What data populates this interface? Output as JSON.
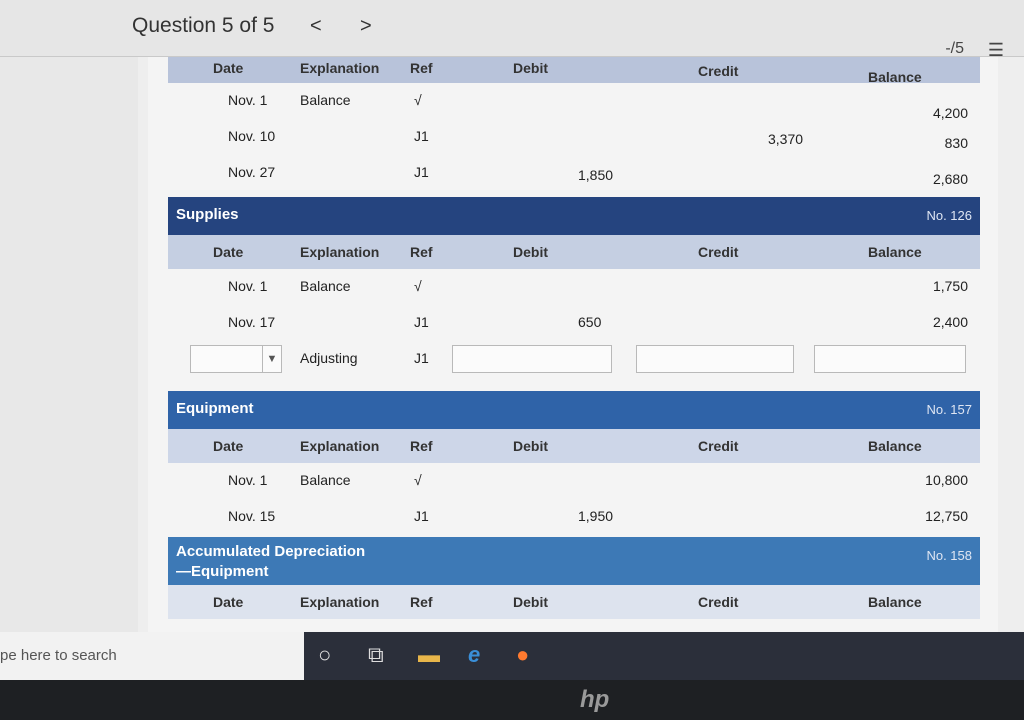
{
  "header": {
    "question": "Question 5 of 5",
    "prev": "<",
    "next": ">",
    "score": "-/5",
    "list_icon": "list-icon"
  },
  "columns": {
    "date": "Date",
    "explanation": "Explanation",
    "ref": "Ref",
    "debit": "Debit",
    "credit": "Credit",
    "balance": "Balance"
  },
  "cash": {
    "rows": [
      {
        "date": "Nov. 1",
        "exp": "Balance",
        "ref": "√",
        "debit": "",
        "credit": "",
        "balance": "4,200"
      },
      {
        "date": "Nov. 10",
        "exp": "",
        "ref": "J1",
        "debit": "",
        "credit": "3,370",
        "balance": "830"
      },
      {
        "date": "Nov. 27",
        "exp": "",
        "ref": "J1",
        "debit": "1,850",
        "credit": "",
        "balance": "2,680"
      }
    ]
  },
  "supplies": {
    "title": "Supplies",
    "no": "No. 126",
    "rows": [
      {
        "date": "Nov. 1",
        "exp": "Balance",
        "ref": "√",
        "debit": "",
        "credit": "",
        "balance": "1,750"
      },
      {
        "date": "Nov. 17",
        "exp": "",
        "ref": "J1",
        "debit": "650",
        "credit": "",
        "balance": "2,400"
      }
    ],
    "adjusting": {
      "exp": "Adjusting",
      "ref": "J1"
    }
  },
  "equipment": {
    "title": "Equipment",
    "no": "No. 157",
    "rows": [
      {
        "date": "Nov. 1",
        "exp": "Balance",
        "ref": "√",
        "debit": "",
        "credit": "",
        "balance": "10,800"
      },
      {
        "date": "Nov. 15",
        "exp": "",
        "ref": "J1",
        "debit": "1,950",
        "credit": "",
        "balance": "12,750"
      }
    ]
  },
  "accum": {
    "title_line1": "Accumulated Depreciation",
    "title_line2": "—Equipment",
    "no": "No. 158"
  },
  "taskbar": {
    "search": "pe here to search"
  },
  "bezel": {
    "logo": "hp"
  },
  "colors": {
    "dark_header": "#25447f",
    "mid_header": "#2f63a8",
    "light_header": "#3d79b6"
  }
}
